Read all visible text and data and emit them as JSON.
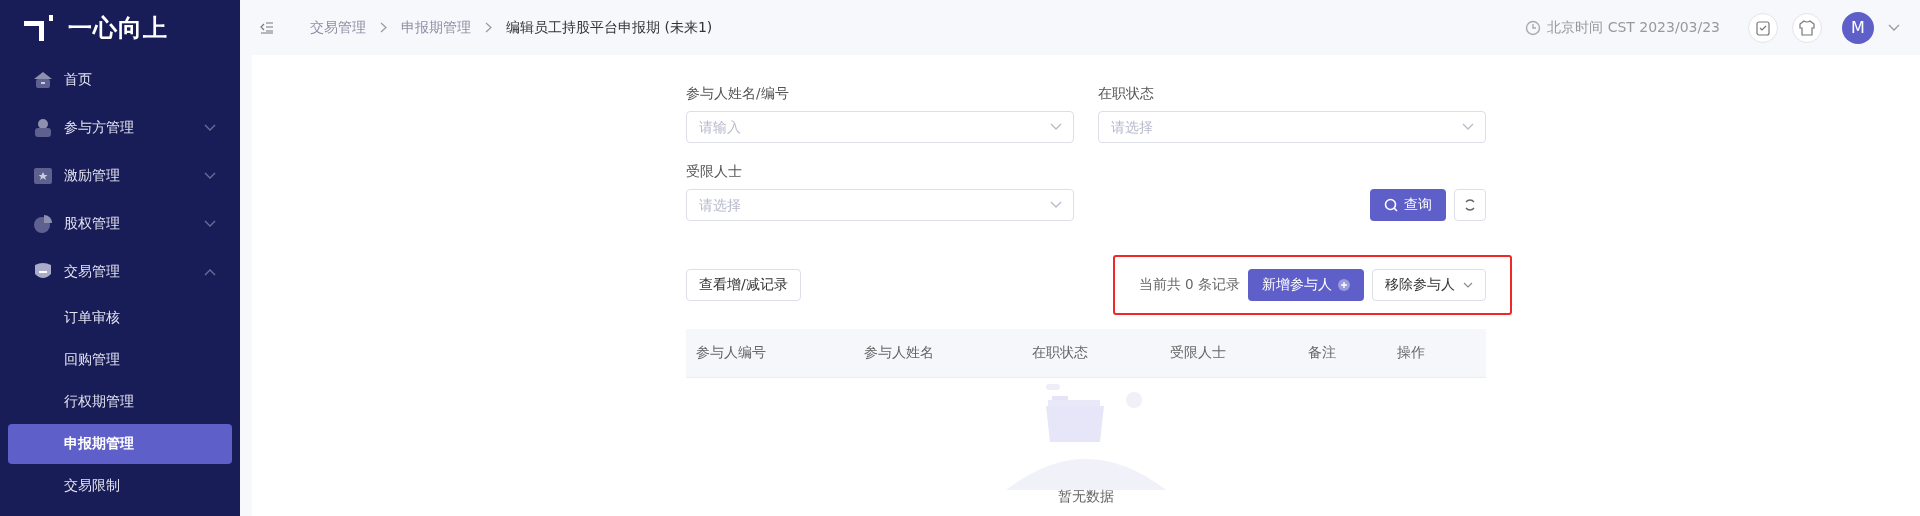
{
  "sidebar": {
    "logo": "一心向上",
    "items": [
      {
        "label": "首页",
        "selected": false
      },
      {
        "label": "参与方管理",
        "expanded": false,
        "selected": false
      },
      {
        "label": "激励管理",
        "expanded": false,
        "selected": false
      },
      {
        "label": "股权管理",
        "expanded": false,
        "selected": false
      },
      {
        "label": "交易管理",
        "expanded": true,
        "selected": false,
        "children": [
          {
            "label": "订单审核",
            "selected": false
          },
          {
            "label": "回购管理",
            "selected": false
          },
          {
            "label": "行权期管理",
            "selected": false
          },
          {
            "label": "申报期管理",
            "selected": true
          },
          {
            "label": "交易限制",
            "selected": false
          }
        ]
      }
    ]
  },
  "header": {
    "breadcrumb": [
      "交易管理",
      "申报期管理",
      "编辑员工持股平台申报期 (未来1)"
    ],
    "time": "北京时间 CST 2023/03/23",
    "avatar": "M"
  },
  "filters": [
    {
      "label": "参与人姓名/编号",
      "placeholder": "请输入"
    },
    {
      "label": "在职状态",
      "placeholder": "请选择"
    },
    {
      "label": "受限人士",
      "placeholder": "请选择"
    }
  ],
  "search_button": "查询",
  "toolbar": {
    "history_button": "查看增/减记录",
    "count_text": "当前共 0 条记录",
    "add_button": "新增参与人",
    "remove_button": "移除参与人",
    "highlighted": true
  },
  "table": {
    "columns": [
      "参与人编号",
      "参与人姓名",
      "在职状态",
      "受限人士",
      "备注",
      "操作"
    ],
    "empty_text": "暂无数据"
  }
}
